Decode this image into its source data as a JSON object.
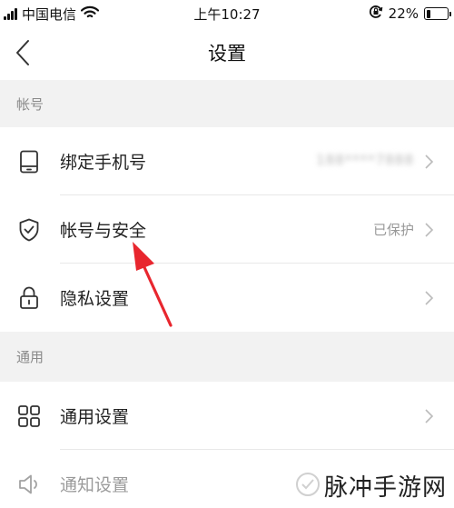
{
  "status_bar": {
    "carrier": "中国电信",
    "time": "上午10:27",
    "battery_percent": "22%",
    "battery_level": 0.22
  },
  "nav": {
    "title": "设置"
  },
  "sections": {
    "account": {
      "header": "帐号",
      "rows": {
        "bind_phone": {
          "label": "绑定手机号",
          "value": "188****7888",
          "icon": "phone-icon"
        },
        "account_security": {
          "label": "帐号与安全",
          "value": "已保护",
          "icon": "shield-check-icon"
        },
        "privacy": {
          "label": "隐私设置",
          "icon": "lock-icon"
        }
      }
    },
    "general": {
      "header": "通用",
      "rows": {
        "general_settings": {
          "label": "通用设置",
          "icon": "grid-icon"
        },
        "notification_settings": {
          "label": "通知设置",
          "icon": "speaker-icon"
        }
      }
    }
  },
  "watermark": {
    "text": "脉冲手游网"
  },
  "colors": {
    "section_bg": "#f2f2f2",
    "annotation_arrow": "#e8262e"
  }
}
